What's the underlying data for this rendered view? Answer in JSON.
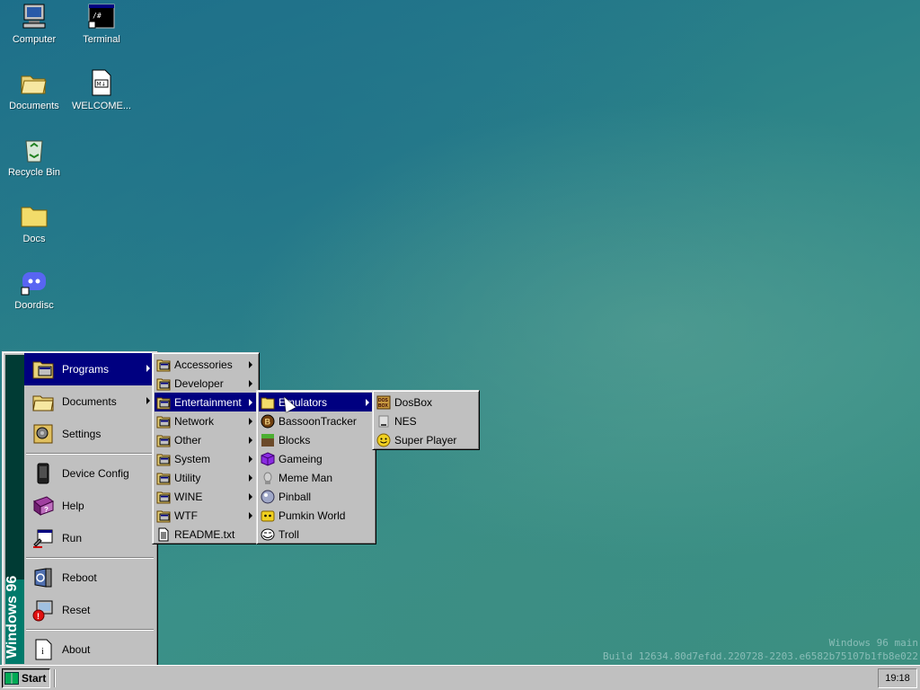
{
  "desktop": {
    "icons": [
      {
        "label": "Computer",
        "icon": "computer-icon"
      },
      {
        "label": "Terminal",
        "icon": "terminal-icon"
      },
      {
        "label": "Documents",
        "icon": "folder-open-icon"
      },
      {
        "label": "WELCOME...",
        "icon": "markdown-file-icon"
      },
      {
        "label": "Recycle Bin",
        "icon": "recycle-bin-icon"
      },
      {
        "label": "Docs",
        "icon": "folder-icon"
      },
      {
        "label": "Doordisc",
        "icon": "discord-icon"
      }
    ],
    "watermark_line1": "Windows 96 main",
    "watermark_line2": "Build 12634.80d7efdd.220728-2203.e6582b75107b1fb8e022"
  },
  "start_menu": {
    "banner": "Windows 96",
    "items": [
      {
        "label": "Programs",
        "icon": "programs-icon",
        "submenu": true,
        "selected": true
      },
      {
        "label": "Documents",
        "icon": "documents-icon",
        "submenu": true
      },
      {
        "label": "Settings",
        "icon": "settings-icon"
      },
      {
        "label": "Device Config",
        "icon": "device-config-icon"
      },
      {
        "label": "Help",
        "icon": "help-book-icon"
      },
      {
        "label": "Run",
        "icon": "run-icon"
      },
      {
        "label": "Reboot",
        "icon": "reboot-icon"
      },
      {
        "label": "Reset",
        "icon": "reset-icon"
      },
      {
        "label": "About",
        "icon": "about-icon"
      }
    ]
  },
  "programs_menu": {
    "items": [
      {
        "label": "Accessories",
        "submenu": true
      },
      {
        "label": "Developer",
        "submenu": true
      },
      {
        "label": "Entertainment",
        "submenu": true,
        "selected": true
      },
      {
        "label": "Network",
        "submenu": true
      },
      {
        "label": "Other",
        "submenu": true
      },
      {
        "label": "System",
        "submenu": true
      },
      {
        "label": "Utility",
        "submenu": true
      },
      {
        "label": "WINE",
        "submenu": true
      },
      {
        "label": "WTF",
        "submenu": true
      },
      {
        "label": "README.txt",
        "submenu": false
      }
    ]
  },
  "entertainment_menu": {
    "items": [
      {
        "label": "Emulators",
        "submenu": true,
        "selected": true
      },
      {
        "label": "BassoonTracker"
      },
      {
        "label": "Blocks"
      },
      {
        "label": "Gameing"
      },
      {
        "label": "Meme Man"
      },
      {
        "label": "Pinball"
      },
      {
        "label": "Pumkin World"
      },
      {
        "label": "Troll"
      }
    ]
  },
  "emulators_menu": {
    "items": [
      {
        "label": "DosBox"
      },
      {
        "label": "NES"
      },
      {
        "label": "Super Player"
      }
    ]
  },
  "taskbar": {
    "start_label": "Start",
    "clock": "19:18"
  },
  "colors": {
    "selection": "#000080",
    "menu_bg": "#c0c0c0",
    "banner": "#007a6b"
  }
}
